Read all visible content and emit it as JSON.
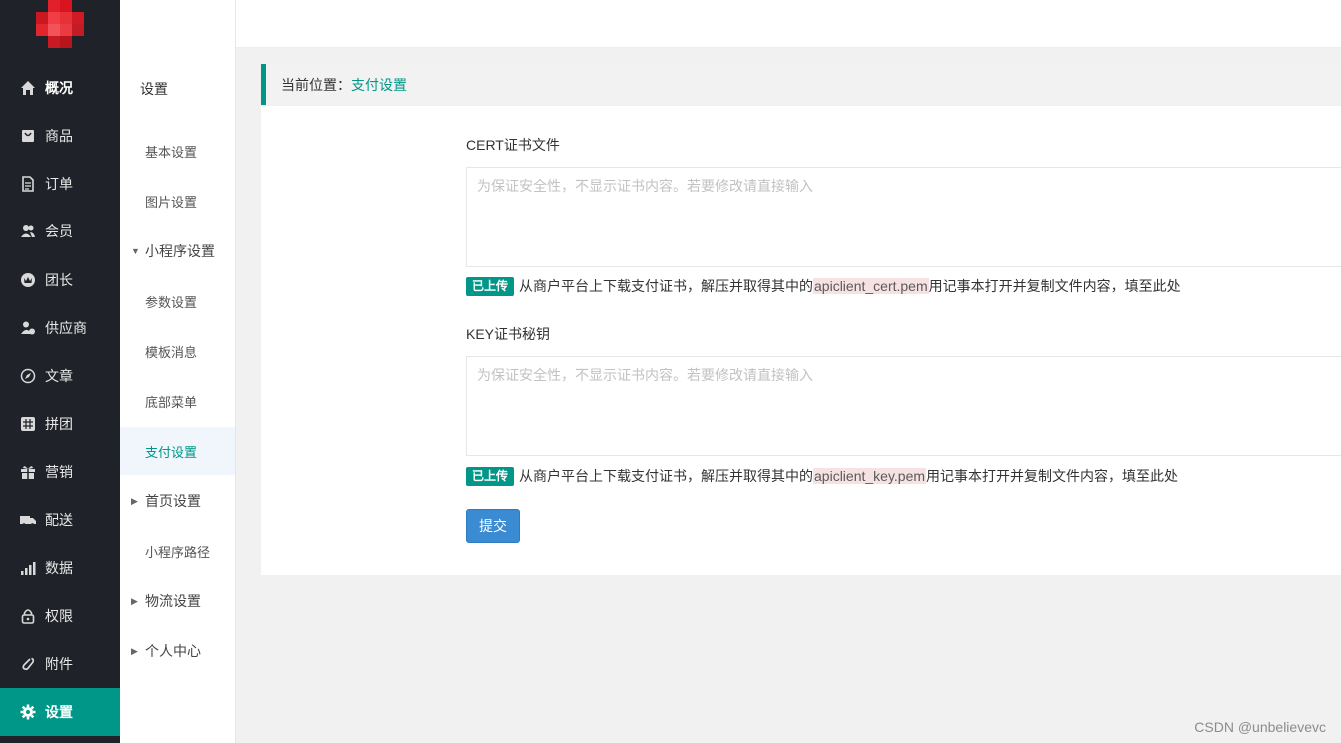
{
  "sidebar": {
    "items": [
      {
        "label": "概况",
        "icon": "home-icon"
      },
      {
        "label": "商品",
        "icon": "shopping-bag-icon"
      },
      {
        "label": "订单",
        "icon": "document-icon"
      },
      {
        "label": "会员",
        "icon": "users-icon"
      },
      {
        "label": "团长",
        "icon": "crown-icon"
      },
      {
        "label": "供应商",
        "icon": "supplier-icon"
      },
      {
        "label": "文章",
        "icon": "compass-icon"
      },
      {
        "label": "拼团",
        "icon": "hash-icon"
      },
      {
        "label": "营销",
        "icon": "gift-icon"
      },
      {
        "label": "配送",
        "icon": "truck-icon"
      },
      {
        "label": "数据",
        "icon": "bar-chart-icon"
      },
      {
        "label": "权限",
        "icon": "lock-icon"
      },
      {
        "label": "附件",
        "icon": "paperclip-icon"
      },
      {
        "label": "设置",
        "icon": "gear-icon"
      }
    ],
    "active": "设置"
  },
  "subnav": {
    "title": "设置",
    "items": [
      {
        "label": "基本设置"
      },
      {
        "label": "图片设置"
      },
      {
        "label": "小程序设置",
        "arrow": "▼"
      },
      {
        "label": "参数设置"
      },
      {
        "label": "模板消息"
      },
      {
        "label": "底部菜单"
      },
      {
        "label": "支付设置"
      },
      {
        "label": "首页设置",
        "arrow": "▶"
      },
      {
        "label": "小程序路径"
      },
      {
        "label": "物流设置",
        "arrow": "▶"
      },
      {
        "label": "个人中心",
        "arrow": "▶"
      }
    ]
  },
  "breadcrumb": {
    "prefix": "当前位置：",
    "current": "支付设置"
  },
  "form": {
    "cert": {
      "label": "CERT证书文件",
      "placeholder": "为保证安全性，不显示证书内容。若要修改请直接输入",
      "badge": "已上传",
      "hint_before": "从商户平台上下载支付证书，解压并取得其中的",
      "hint_code": "apiclient_cert.pem",
      "hint_after": "用记事本打开并复制文件内容，填至此处"
    },
    "key": {
      "label": "KEY证书秘钥",
      "placeholder": "为保证安全性，不显示证书内容。若要修改请直接输入",
      "badge": "已上传",
      "hint_before": "从商户平台上下载支付证书，解压并取得其中的",
      "hint_code": "apiclient_key.pem",
      "hint_after": "用记事本打开并复制文件内容，填至此处"
    },
    "submit_label": "提交"
  },
  "watermark": "CSDN @unbelievevc",
  "colors": {
    "accent": "#009688",
    "sidebar_bg": "#1f2329",
    "button": "#3a8bd1"
  }
}
